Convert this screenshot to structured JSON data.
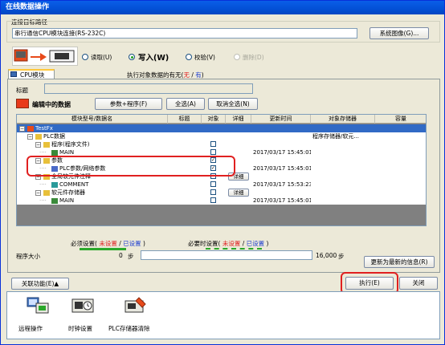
{
  "window": {
    "title": "在线数据操作"
  },
  "connection": {
    "group_label": "连接目标路径",
    "path_value": "串行通信CPU模块连接(RS-232C)",
    "system_image_button": "系统图像(G)..."
  },
  "mode": {
    "read_label": "读取(U)",
    "write_label": "写入(W)",
    "verify_label": "校验(V)",
    "delete_label": "删除(D)"
  },
  "tab": {
    "cpu_module": "CPU模块"
  },
  "target_info": {
    "prefix": "执行对象数据的有无(",
    "none": "无",
    "sep": "/",
    "has": "有",
    "suffix": ")"
  },
  "title_field": {
    "label": "标题",
    "value": ""
  },
  "editing": {
    "label": "编辑中的数据",
    "params_program_button": "参数+程序(F)",
    "select_all_button": "全选(A)",
    "deselect_all_button": "取消全选(N)"
  },
  "grid": {
    "headers": [
      "模块型号/数据名",
      "标题",
      "对象",
      "详细",
      "更新时间",
      "对象存储器",
      "容量"
    ],
    "rows": [
      {
        "name": "TestFx",
        "level": 0,
        "expand": "−",
        "icon": "plc",
        "checked": false,
        "has_check": false,
        "detail": "",
        "time": "",
        "storage": "",
        "selected": true
      },
      {
        "name": "PLC数据",
        "level": 1,
        "expand": "−",
        "icon": "folder",
        "checked": false,
        "has_check": false,
        "detail": "",
        "time": "",
        "storage": "程序存储器/软元...",
        "selected": false
      },
      {
        "name": "程序(程序文件)",
        "level": 2,
        "expand": "−",
        "icon": "folder",
        "checked": false,
        "has_check": true,
        "detail": "",
        "time": "",
        "storage": "",
        "selected": false
      },
      {
        "name": "MAIN",
        "level": 3,
        "expand": "",
        "icon": "prog",
        "checked": false,
        "has_check": true,
        "detail": "",
        "time": "2017/03/17 15:45:01",
        "storage": "",
        "selected": false
      },
      {
        "name": "参数",
        "level": 2,
        "expand": "−",
        "icon": "folder",
        "checked": true,
        "has_check": true,
        "detail": "",
        "time": "",
        "storage": "",
        "selected": false
      },
      {
        "name": "PLC参数/网络参数",
        "level": 3,
        "expand": "",
        "icon": "param",
        "checked": true,
        "has_check": true,
        "detail": "",
        "time": "2017/03/17 15:45:01",
        "storage": "",
        "selected": false
      },
      {
        "name": "全局软元件注释",
        "level": 2,
        "expand": "−",
        "icon": "folder",
        "checked": false,
        "has_check": true,
        "detail": "详细",
        "time": "",
        "storage": "",
        "selected": false
      },
      {
        "name": "COMMENT",
        "level": 3,
        "expand": "",
        "icon": "comment",
        "checked": false,
        "has_check": true,
        "detail": "",
        "time": "2017/03/17 15:53:23",
        "storage": "",
        "selected": false
      },
      {
        "name": "软元件存储器",
        "level": 2,
        "expand": "−",
        "icon": "folder",
        "checked": false,
        "has_check": true,
        "detail": "详细",
        "time": "",
        "storage": "",
        "selected": false
      },
      {
        "name": "MAIN",
        "level": 3,
        "expand": "",
        "icon": "prog",
        "checked": false,
        "has_check": true,
        "detail": "",
        "time": "2017/03/17 15:45:01",
        "storage": "",
        "selected": false
      }
    ]
  },
  "settings": {
    "required_label": "必须设置(",
    "required_not_set": "未设置",
    "sep": "/",
    "required_set": "已设置",
    "close_paren": ")",
    "needed_label": "必要时设置(",
    "needed_not_set": "未设置",
    "needed_set": "已设置"
  },
  "program_size": {
    "label": "程序大小",
    "used": "0",
    "unit": "步",
    "total": "16,000",
    "total_unit": "步"
  },
  "update_button": "更新为最新的信息(R)",
  "footer": {
    "related_button": "关联功能(E)▲",
    "execute_button": "执行(E)",
    "close_button": "关闭"
  },
  "related": [
    {
      "label": "远程操作",
      "icon": "remote-operation-icon"
    },
    {
      "label": "时钟设置",
      "icon": "clock-setting-icon"
    },
    {
      "label": "PLC存储器清除",
      "icon": "plc-memory-clear-icon"
    }
  ],
  "colors": {
    "red": "#e02020",
    "blue": "#1f3fd0",
    "accent": "#316ac5"
  }
}
